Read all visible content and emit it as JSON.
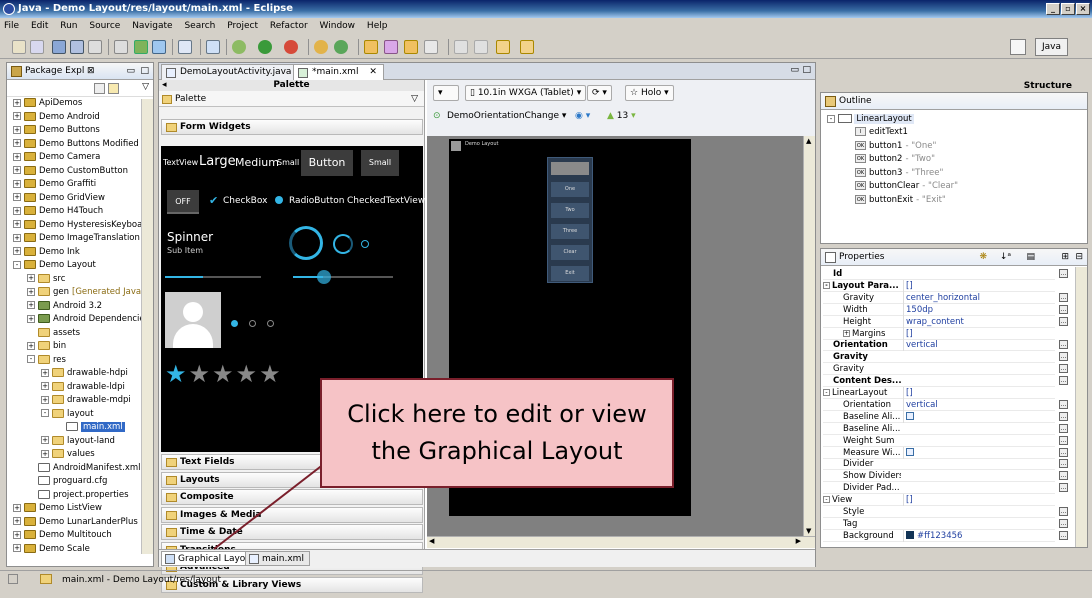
{
  "window": {
    "title": "Java - Demo Layout/res/layout/main.xml - Eclipse"
  },
  "menu": [
    "File",
    "Edit",
    "Run",
    "Source",
    "Navigate",
    "Search",
    "Project",
    "Refactor",
    "Window",
    "Help"
  ],
  "perspective": "Java",
  "package_explorer": {
    "title": "Package Expl",
    "items": [
      {
        "label": "ApiDemos",
        "indent": 0,
        "pm": "+",
        "icon": "proj"
      },
      {
        "label": "Demo Android",
        "indent": 0,
        "pm": "+",
        "icon": "proj"
      },
      {
        "label": "Demo Buttons",
        "indent": 0,
        "pm": "+",
        "icon": "proj"
      },
      {
        "label": "Demo Buttons Modified",
        "indent": 0,
        "pm": "+",
        "icon": "proj"
      },
      {
        "label": "Demo Camera",
        "indent": 0,
        "pm": "+",
        "icon": "proj"
      },
      {
        "label": "Demo CustomButton",
        "indent": 0,
        "pm": "+",
        "icon": "proj"
      },
      {
        "label": "Demo Graffiti",
        "indent": 0,
        "pm": "+",
        "icon": "proj"
      },
      {
        "label": "Demo GridView",
        "indent": 0,
        "pm": "+",
        "icon": "proj"
      },
      {
        "label": "Demo H4Touch",
        "indent": 0,
        "pm": "+",
        "icon": "proj"
      },
      {
        "label": "Demo HysteresisKeyboar",
        "indent": 0,
        "pm": "+",
        "icon": "proj"
      },
      {
        "label": "Demo ImageTranslation",
        "indent": 0,
        "pm": "+",
        "icon": "proj"
      },
      {
        "label": "Demo Ink",
        "indent": 0,
        "pm": "+",
        "icon": "proj"
      },
      {
        "label": "Demo Layout",
        "indent": 0,
        "pm": "-",
        "icon": "proj"
      },
      {
        "label": "src",
        "indent": 1,
        "pm": "+",
        "icon": "fold"
      },
      {
        "label": "gen",
        "extra": "[Generated Java",
        "indent": 1,
        "pm": "+",
        "icon": "fold"
      },
      {
        "label": "Android 3.2",
        "indent": 1,
        "pm": "+",
        "icon": "jar"
      },
      {
        "label": "Android Dependencie",
        "indent": 1,
        "pm": "+",
        "icon": "jar"
      },
      {
        "label": "assets",
        "indent": 1,
        "pm": "",
        "icon": "fold"
      },
      {
        "label": "bin",
        "indent": 1,
        "pm": "+",
        "icon": "fold"
      },
      {
        "label": "res",
        "indent": 1,
        "pm": "-",
        "icon": "fold"
      },
      {
        "label": "drawable-hdpi",
        "indent": 2,
        "pm": "+",
        "icon": "fold"
      },
      {
        "label": "drawable-ldpi",
        "indent": 2,
        "pm": "+",
        "icon": "fold"
      },
      {
        "label": "drawable-mdpi",
        "indent": 2,
        "pm": "+",
        "icon": "fold"
      },
      {
        "label": "layout",
        "indent": 2,
        "pm": "-",
        "icon": "fold"
      },
      {
        "label": "main.xml",
        "indent": 3,
        "pm": "",
        "icon": "filei",
        "selected": true
      },
      {
        "label": "layout-land",
        "indent": 2,
        "pm": "+",
        "icon": "fold"
      },
      {
        "label": "values",
        "indent": 2,
        "pm": "+",
        "icon": "fold"
      },
      {
        "label": "AndroidManifest.xml",
        "indent": 1,
        "pm": "",
        "icon": "filei"
      },
      {
        "label": "proguard.cfg",
        "indent": 1,
        "pm": "",
        "icon": "filei"
      },
      {
        "label": "project.properties",
        "indent": 1,
        "pm": "",
        "icon": "filei"
      },
      {
        "label": "Demo ListView",
        "indent": 0,
        "pm": "+",
        "icon": "proj"
      },
      {
        "label": "Demo LunarLanderPlus",
        "indent": 0,
        "pm": "+",
        "icon": "proj"
      },
      {
        "label": "Demo Multitouch",
        "indent": 0,
        "pm": "+",
        "icon": "proj"
      },
      {
        "label": "Demo Scale",
        "indent": 0,
        "pm": "+",
        "icon": "proj"
      }
    ]
  },
  "editor": {
    "tabs": [
      {
        "label": "DemoLayoutActivity.java",
        "active": false
      },
      {
        "label": "*main.xml",
        "active": true
      }
    ],
    "bottom_tabs": [
      {
        "label": "Graphical Layout",
        "active": true
      },
      {
        "label": "main.xml",
        "active": false
      }
    ],
    "palette": {
      "header": "Palette",
      "subheader": "Palette",
      "open_category": "Form Widgets",
      "categories": [
        "Text Fields",
        "Layouts",
        "Composite",
        "Images & Media",
        "Time & Date",
        "Transitions",
        "Advanced",
        "Custom & Library Views"
      ],
      "widgets": {
        "textview": "TextView",
        "large": "Large",
        "medium": "Medium",
        "small": "Small",
        "button": "Button",
        "small_button": "Small",
        "toggle": "OFF",
        "checkbox": "CheckBox",
        "radio": "RadioButton",
        "checked_text": "CheckedTextView",
        "spinner": "Spinner",
        "sub_item": "Sub Item"
      }
    },
    "canvas_bar": {
      "device": "10.1in WXGA (Tablet)",
      "theme": "Holo",
      "activity": "DemoOrientationChange",
      "api": "13"
    },
    "device_screen": {
      "app_title": "Demo Layout",
      "buttons": [
        "One",
        "Two",
        "Three",
        "Clear",
        "Exit"
      ]
    }
  },
  "structure": {
    "header": "Structure"
  },
  "outline": {
    "title": "Outline",
    "root": "LinearLayout",
    "children": [
      {
        "name": "editText1",
        "desc": ""
      },
      {
        "name": "button1",
        "desc": "- \"One\""
      },
      {
        "name": "button2",
        "desc": "- \"Two\""
      },
      {
        "name": "button3",
        "desc": "- \"Three\""
      },
      {
        "name": "buttonClear",
        "desc": "- \"Clear\""
      },
      {
        "name": "buttonExit",
        "desc": "- \"Exit\""
      }
    ]
  },
  "properties": {
    "title": "Properties",
    "rows": [
      {
        "key": "Id",
        "value": "",
        "bold": true,
        "dots": true
      },
      {
        "key": "Layout Para...",
        "value": "[]",
        "bold": true,
        "group": "-"
      },
      {
        "key": "Gravity",
        "value": "center_horizontal",
        "indent": true,
        "dots": true
      },
      {
        "key": "Width",
        "value": "150dp",
        "indent": true,
        "dots": true
      },
      {
        "key": "Height",
        "value": "wrap_content",
        "indent": true,
        "dots": true
      },
      {
        "key": "Margins",
        "value": "[]",
        "indent": true,
        "group": "+"
      },
      {
        "key": "Orientation",
        "value": "vertical",
        "bold": true,
        "dots": true
      },
      {
        "key": "Gravity",
        "value": "",
        "bold": true,
        "dots": true
      },
      {
        "key": "Gravity",
        "value": "",
        "dots": true
      },
      {
        "key": "Content Des...",
        "value": "",
        "bold": true,
        "dots": true
      },
      {
        "key": "LinearLayout",
        "value": "[]",
        "group": "-"
      },
      {
        "key": "Orientation",
        "value": "vertical",
        "indent": true,
        "dots": true
      },
      {
        "key": "Baseline Ali...",
        "value": "",
        "indent": true,
        "check": true,
        "dots": true
      },
      {
        "key": "Baseline Ali...",
        "value": "",
        "indent": true,
        "dots": true
      },
      {
        "key": "Weight Sum",
        "value": "",
        "indent": true,
        "dots": true
      },
      {
        "key": "Measure Wi...",
        "value": "",
        "indent": true,
        "check": true,
        "dots": true
      },
      {
        "key": "Divider",
        "value": "",
        "indent": true,
        "dots": true
      },
      {
        "key": "Show Dividers",
        "value": "",
        "indent": true,
        "dots": true
      },
      {
        "key": "Divider Pad...",
        "value": "",
        "indent": true,
        "dots": true
      },
      {
        "key": "View",
        "value": "[]",
        "group": "-"
      },
      {
        "key": "Style",
        "value": "",
        "indent": true,
        "dots": true
      },
      {
        "key": "Tag",
        "value": "",
        "indent": true,
        "dots": true
      },
      {
        "key": "Background",
        "value": "#ff123456",
        "indent": true,
        "swatch": "#123456",
        "dots": true
      }
    ]
  },
  "status": {
    "text": "main.xml - Demo Layout/res/layout"
  },
  "callout": {
    "line1": "Click here to edit or view",
    "line2": "the Graphical Layout"
  },
  "colors": {
    "selection": "#3169c6",
    "callout_fill": "#f6c3c6",
    "callout_border": "#7a1f2b",
    "holo_accent": "#33b5e5"
  }
}
